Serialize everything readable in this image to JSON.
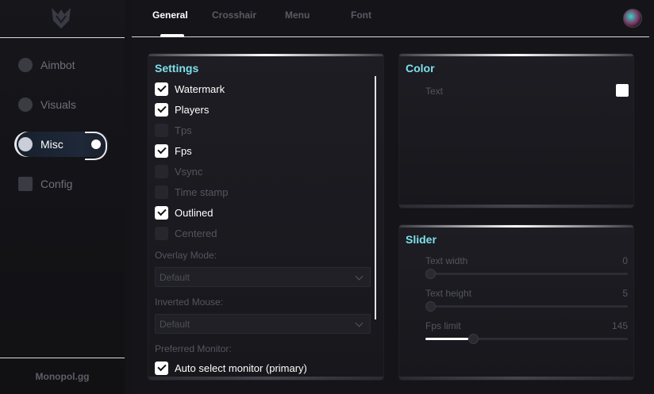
{
  "sidebar": {
    "logo_icon": "wolf-logo-icon",
    "items": [
      {
        "label": "Aimbot",
        "icon": "skull-icon",
        "active": false
      },
      {
        "label": "Visuals",
        "icon": "eye-icon",
        "active": false
      },
      {
        "label": "Misc",
        "icon": "gear-icon",
        "active": true
      },
      {
        "label": "Config",
        "icon": "folder-icon",
        "active": false
      }
    ],
    "footer": "Monopol.gg"
  },
  "tabs": [
    {
      "label": "General",
      "active": true
    },
    {
      "label": "Crosshair",
      "active": false
    },
    {
      "label": "Menu",
      "active": false
    },
    {
      "label": "Font",
      "active": false
    }
  ],
  "settings": {
    "title": "Settings",
    "checkboxes": [
      {
        "label": "Watermark",
        "checked": true
      },
      {
        "label": "Players",
        "checked": true
      },
      {
        "label": "Tps",
        "checked": false
      },
      {
        "label": "Fps",
        "checked": true
      },
      {
        "label": "Vsync",
        "checked": false
      },
      {
        "label": "Time stamp",
        "checked": false
      },
      {
        "label": "Outlined",
        "checked": true
      },
      {
        "label": "Centered",
        "checked": false
      }
    ],
    "overlay_mode_label": "Overlay Mode:",
    "overlay_mode_value": "Default",
    "inverted_mouse_label": "Inverted Mouse:",
    "inverted_mouse_value": "Default",
    "preferred_monitor_label": "Preferred Monitor:",
    "auto_select_label": "Auto select monitor (primary)",
    "auto_select_checked": true
  },
  "color": {
    "title": "Color",
    "text_label": "Text",
    "text_color": "#ffffff"
  },
  "slider": {
    "title": "Slider",
    "items": [
      {
        "label": "Text width",
        "value": "0",
        "fraction": 0.0
      },
      {
        "label": "Text height",
        "value": "5",
        "fraction": 0.0
      },
      {
        "label": "Fps limit",
        "value": "145",
        "fraction": 0.21
      }
    ]
  },
  "colors": {
    "accent": "#7ee0ea",
    "background": "#141418",
    "panel": "#1d1d23"
  }
}
